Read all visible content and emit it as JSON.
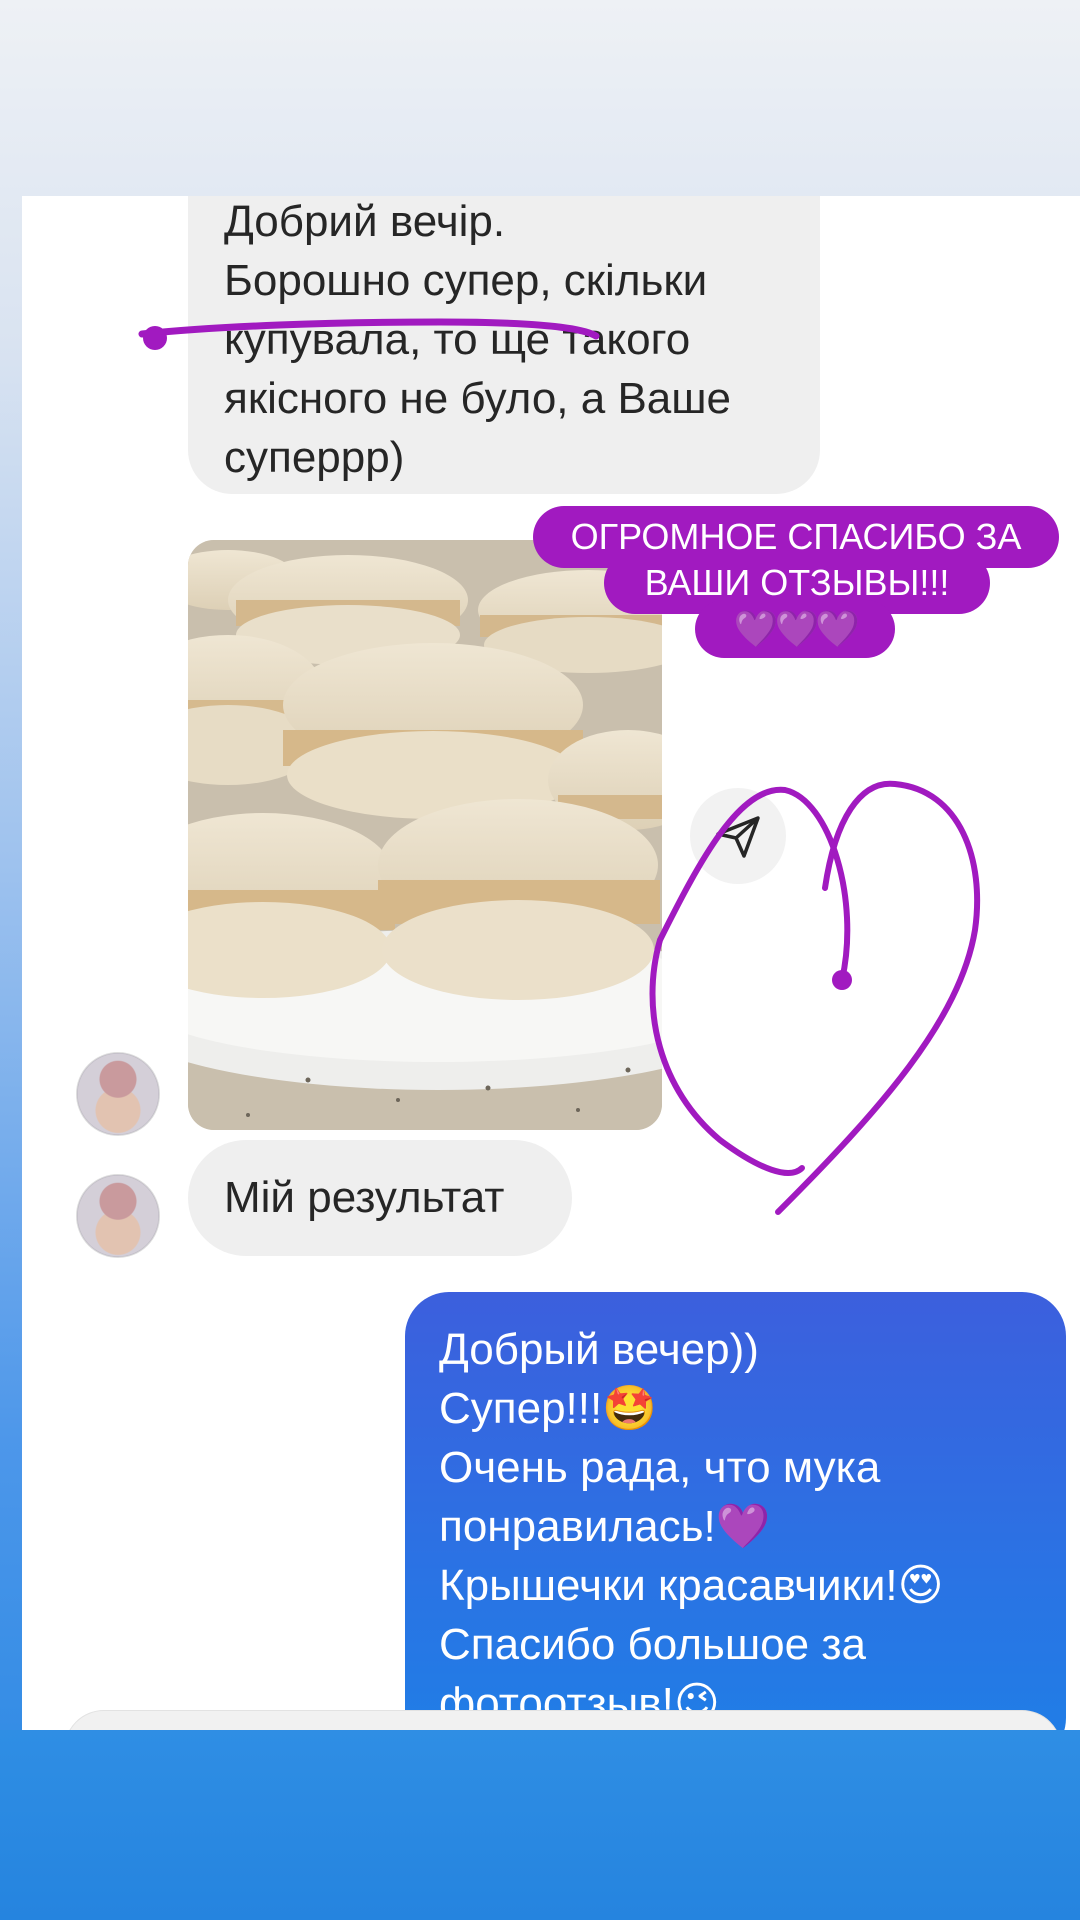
{
  "conversation": {
    "incoming_top": {
      "lines": [
        "Добрий вечір.",
        "Борошно супер, скільки",
        "купувала, то ще такого",
        "якісного не було, а Ваше",
        "суперрр)"
      ]
    },
    "incoming_photo": {
      "description_icon": "macarons-photo"
    },
    "incoming_result": {
      "text": "Мій результат"
    },
    "outgoing_reply": {
      "lines": [
        "Добрый вечер))",
        "Супер!!!🤩",
        "Очень рада, что мука",
        "понравилась!💜",
        "Крышечки красавчики!😍",
        "Спасибо большое за",
        "фотоотзыв!😉"
      ]
    }
  },
  "sticker": {
    "line1": "ОГРОМНОЕ СПАСИБО ЗА",
    "line2": "ВАШИ ОТЗЫВЫ!!!",
    "line3": "💜💜💜"
  },
  "colors": {
    "accent_purple": "#a11ac0",
    "reply_bubble": "#2a73e4",
    "incoming_bubble": "#efefef"
  },
  "icons": {
    "share": "paper-plane-icon",
    "avatar": "user-avatar"
  }
}
